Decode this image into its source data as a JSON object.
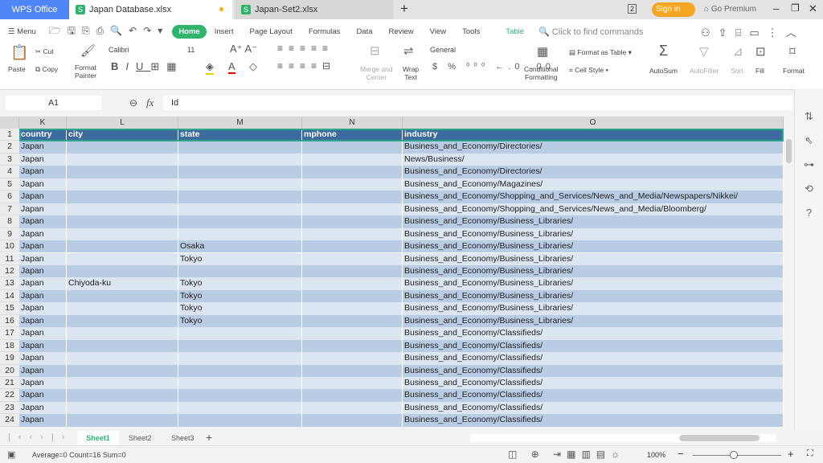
{
  "titlebar": {
    "app": "WPS Office",
    "tabs": [
      "Japan Database.xlsx",
      "Japan-Set2.xlsx"
    ],
    "badge": "2",
    "signin": "Sign in",
    "premium": "Go Premium"
  },
  "menu": {
    "menu_label": "Menu",
    "tabs": [
      "Home",
      "Insert",
      "Page Layout",
      "Formulas",
      "Data",
      "Review",
      "View",
      "Tools",
      "Table"
    ],
    "search_placeholder": "Click to find commands"
  },
  "ribbon": {
    "paste": "Paste",
    "cut": "Cut",
    "copy": "Copy",
    "format_painter_1": "Format",
    "format_painter_2": "Painter",
    "font": "Calibri",
    "size": "11",
    "merge_1": "Merge and",
    "merge_2": "Center",
    "wrap_1": "Wrap",
    "wrap_2": "Text",
    "number_format": "General",
    "cond_1": "Conditional",
    "cond_2": "Formatting",
    "format_table": "Format as Table",
    "cell_style": "Cell Style",
    "autosum": "AutoSum",
    "autofilter": "AutoFilter",
    "sort": "Sort",
    "fill": "Fill",
    "format": "Format"
  },
  "formula_bar": {
    "name_box": "A1",
    "fx": "fx",
    "value": "Id"
  },
  "columns": [
    "K",
    "L",
    "M",
    "N",
    "O"
  ],
  "header_row": [
    "country",
    "city",
    "state",
    "mphone",
    "industry"
  ],
  "rows": [
    [
      "Japan",
      "",
      "",
      "",
      "Business_and_Economy/Directories/"
    ],
    [
      "Japan",
      "",
      "",
      "",
      "News/Business/"
    ],
    [
      "Japan",
      "",
      "",
      "",
      "Business_and_Economy/Directories/"
    ],
    [
      "Japan",
      "",
      "",
      "",
      "Business_and_Economy/Magazines/"
    ],
    [
      "Japan",
      "",
      "",
      "",
      "Business_and_Economy/Shopping_and_Services/News_and_Media/Newspapers/Nikkei/"
    ],
    [
      "Japan",
      "",
      "",
      "",
      "Business_and_Economy/Shopping_and_Services/News_and_Media/Bloomberg/"
    ],
    [
      "Japan",
      "",
      "",
      "",
      "Business_and_Economy/Business_Libraries/"
    ],
    [
      "Japan",
      "",
      "",
      "",
      "Business_and_Economy/Business_Libraries/"
    ],
    [
      "Japan",
      "",
      "Osaka",
      "",
      "Business_and_Economy/Business_Libraries/"
    ],
    [
      "Japan",
      "",
      "Tokyo",
      "",
      "Business_and_Economy/Business_Libraries/"
    ],
    [
      "Japan",
      "",
      "",
      "",
      "Business_and_Economy/Business_Libraries/"
    ],
    [
      "Japan",
      "Chiyoda-ku",
      "Tokyo",
      "",
      "Business_and_Economy/Business_Libraries/"
    ],
    [
      "Japan",
      "",
      "Tokyo",
      "",
      "Business_and_Economy/Business_Libraries/"
    ],
    [
      "Japan",
      "",
      "Tokyo",
      "",
      "Business_and_Economy/Business_Libraries/"
    ],
    [
      "Japan",
      "",
      "Tokyo",
      "",
      "Business_and_Economy/Business_Libraries/"
    ],
    [
      "Japan",
      "",
      "",
      "",
      "Business_and_Economy/Classifieds/"
    ],
    [
      "Japan",
      "",
      "",
      "",
      "Business_and_Economy/Classifieds/"
    ],
    [
      "Japan",
      "",
      "",
      "",
      "Business_and_Economy/Classifieds/"
    ],
    [
      "Japan",
      "",
      "",
      "",
      "Business_and_Economy/Classifieds/"
    ],
    [
      "Japan",
      "",
      "",
      "",
      "Business_and_Economy/Classifieds/"
    ],
    [
      "Japan",
      "",
      "",
      "",
      "Business_and_Economy/Classifieds/"
    ],
    [
      "Japan",
      "",
      "",
      "",
      "Business_and_Economy/Classifieds/"
    ],
    [
      "Japan",
      "",
      "",
      "",
      "Business_and_Economy/Classifieds/"
    ]
  ],
  "sheets": [
    "Sheet1",
    "Sheet2",
    "Sheet3"
  ],
  "status": {
    "summary": "Average=0  Count=16  Sum=0",
    "zoom": "100%"
  },
  "colors": {
    "header": "#3e6b9e",
    "band_dark": "#b8cce4",
    "band_light": "#dce6f1",
    "accent": "#2fb36d",
    "signin": "#f5a623",
    "tab_blue": "#4f86f7"
  }
}
